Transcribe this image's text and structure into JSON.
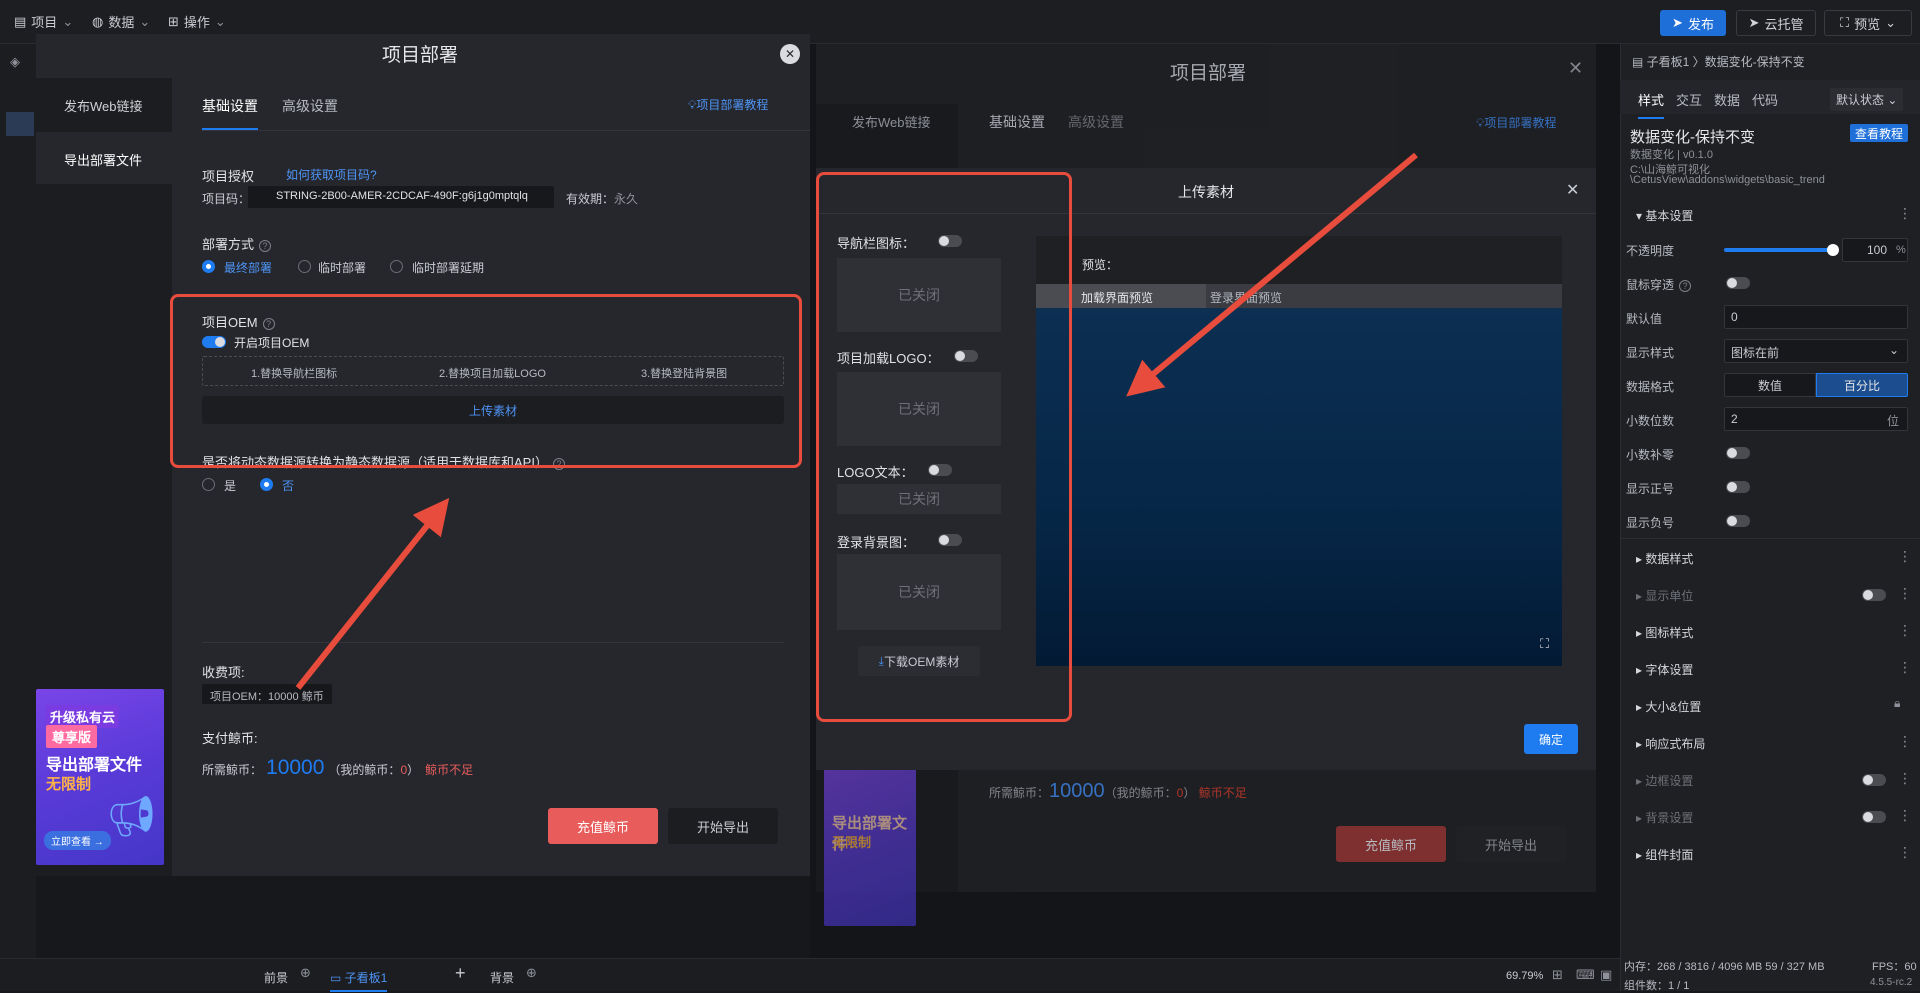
{
  "topbar": {
    "menu": [
      {
        "label": "项目"
      },
      {
        "label": "数据"
      },
      {
        "label": "操作"
      }
    ],
    "publish": "发布",
    "cloud": "云托管",
    "preview": "预览"
  },
  "right_panel": {
    "breadcrumb": "子看板1 〉数据变化-保持不变",
    "tabs": [
      "样式",
      "交互",
      "数据",
      "代码"
    ],
    "state_select": "默认状态",
    "widget_name": "数据变化-保持不变",
    "widget_version": "数据变化 | v0.1.0",
    "widget_path1": "C:\\山海鲸可视化",
    "widget_path2": "\\CetusView\\addons\\widgets\\basic_trend",
    "tutorial_btn": "查看教程",
    "basic_section": "基本设置",
    "opacity_label": "不透明度",
    "opacity_value": "100",
    "opacity_unit": "%",
    "opacity_level": 1.0,
    "mouse_through": "鼠标穿透",
    "default_label": "默认值",
    "default_value": "0",
    "display_style_label": "显示样式",
    "display_style_value": "图标在前",
    "data_format_label": "数据格式",
    "data_format_options": [
      "数值",
      "百分比"
    ],
    "decimals_label": "小数位数",
    "decimals_value": "2",
    "decimals_unit": "位",
    "pad_zero": "小数补零",
    "show_positive": "显示正号",
    "show_negative": "显示负号",
    "sections": [
      "数据样式",
      "显示单位",
      "图标样式",
      "字体设置",
      "大小&位置",
      "响应式布局",
      "边框设置",
      "背景设置",
      "组件封面"
    ],
    "status_memory": "内存：268 / 3816 / 4096 MB 59 / 327 MB",
    "status_fps": "FPS：60",
    "status_count": "组件数：1 / 1",
    "status_version": "4.5.5-rc.2"
  },
  "bottom_bar": {
    "tabs": [
      "前景",
      "子看板1",
      "背景"
    ],
    "zoom": "69.79%"
  },
  "deploy_dialog": {
    "title": "项目部署",
    "side": [
      "发布Web链接",
      "导出部署文件"
    ],
    "tabs": [
      "基础设置",
      "高级设置"
    ],
    "tutorial": "项目部署教程",
    "auth_label": "项目授权",
    "auth_link": "如何获取项目码?",
    "code_label": "项目码：",
    "code_value": "STRING-2B00-AMER-2CDCAF-490F:g6j1g0mptqlq",
    "valid_label": "有效期：",
    "valid_value": "永久",
    "deploy_mode_label": "部署方式",
    "deploy_modes": [
      "最终部署",
      "临时部署",
      "临时部署延期"
    ],
    "oem_label": "项目OEM",
    "oem_toggle": "开启项目OEM",
    "oem_steps": [
      "1.替换导航栏图标",
      "2.替换项目加载LOGO",
      "3.替换登陆背景图"
    ],
    "upload_btn": "上传素材",
    "convert_label": "是否将动态数据源转换为静态数据源（适用于数据库和API）",
    "convert_options": [
      "是",
      "否"
    ],
    "fee_label": "收费项:",
    "fee_item": "项目OEM：10000 鲸币",
    "pay_label": "支付鲸币:",
    "need_label": "所需鲸币：",
    "need_value": "10000",
    "mine_label": "（我的鲸币：",
    "mine_value": "0",
    "mine_close": "）",
    "insufficient": "鲸币不足",
    "recharge_btn": "充值鲸币",
    "export_btn": "开始导出"
  },
  "promo": {
    "line1": "升级私有云",
    "line2": "尊享版",
    "line3": "导出部署文件",
    "line4": "无限制",
    "cta": "立即查看 →"
  },
  "upload_dialog": {
    "title": "上传素材",
    "nav_icon_label": "导航栏图标：",
    "loading_logo_label": "项目加载LOGO：",
    "logo_text_label": "LOGO文本：",
    "login_bg_label": "登录背景图：",
    "closed": "已关闭",
    "download_btn": "下载OEM素材",
    "preview_label": "预览：",
    "preview_tabs": [
      "加载界面预览",
      "登录界面预览"
    ],
    "confirm_btn": "确定"
  },
  "colors": {
    "accent": "#1e7cf0",
    "danger_btn": "#e95c5c",
    "annotation": "#e74c3c"
  }
}
